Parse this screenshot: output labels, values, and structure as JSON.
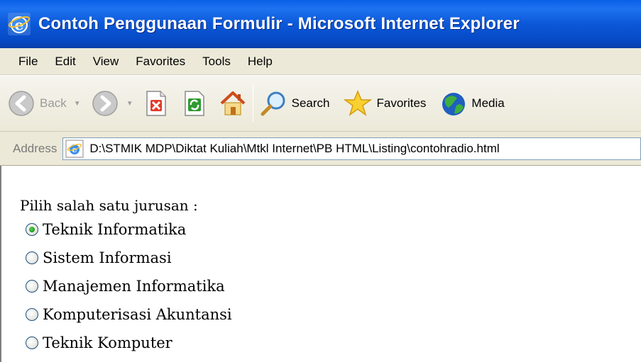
{
  "window": {
    "title": "Contoh Penggunaan Formulir - Microsoft Internet Explorer"
  },
  "menu": [
    "File",
    "Edit",
    "View",
    "Favorites",
    "Tools",
    "Help"
  ],
  "toolbar": {
    "back_label": "Back",
    "search_label": "Search",
    "favorites_label": "Favorites",
    "media_label": "Media"
  },
  "address": {
    "label": "Address",
    "url": "D:\\STMIK MDP\\Diktat Kuliah\\Mtkl Internet\\PB HTML\\Listing\\contohradio.html"
  },
  "form": {
    "prompt": "Pilih salah satu jurusan :",
    "options": [
      {
        "label": "Teknik Informatika",
        "checked": true
      },
      {
        "label": "Sistem Informasi",
        "checked": false
      },
      {
        "label": "Manajemen Informatika",
        "checked": false
      },
      {
        "label": "Komputerisasi Akuntansi",
        "checked": false
      },
      {
        "label": "Teknik Komputer",
        "checked": false
      }
    ]
  },
  "colors": {
    "titlebar": "#0b58d8",
    "chrome": "#ece9d8",
    "radio_check": "#21a121"
  }
}
